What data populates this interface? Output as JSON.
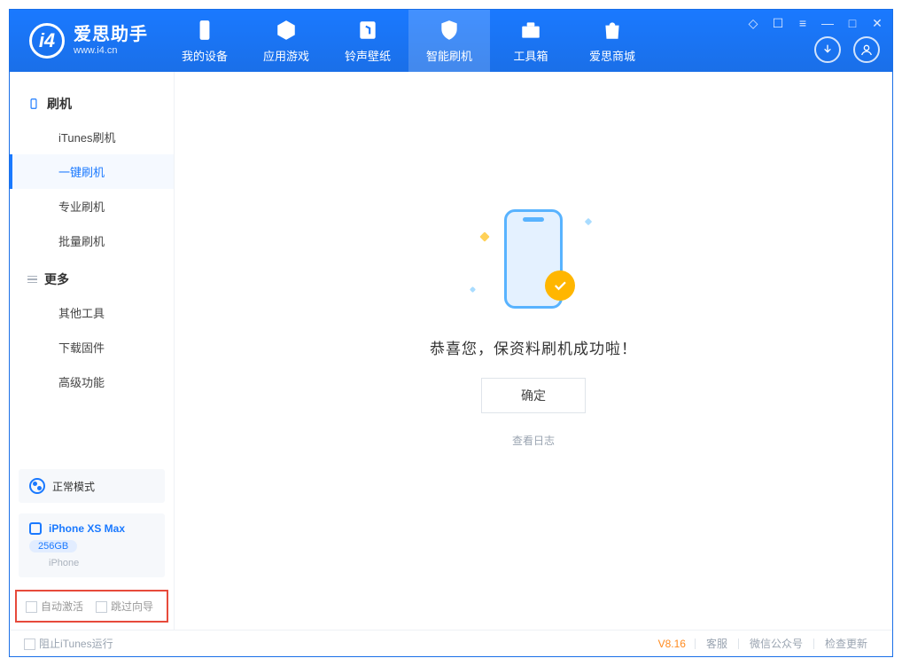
{
  "app": {
    "name_cn": "爱思助手",
    "url": "www.i4.cn"
  },
  "tabs": [
    {
      "label": "我的设备"
    },
    {
      "label": "应用游戏"
    },
    {
      "label": "铃声壁纸"
    },
    {
      "label": "智能刷机"
    },
    {
      "label": "工具箱"
    },
    {
      "label": "爱思商城"
    }
  ],
  "sidebar": {
    "group1": {
      "title": "刷机",
      "items": [
        "iTunes刷机",
        "一键刷机",
        "专业刷机",
        "批量刷机"
      ],
      "active_index": 1
    },
    "group2": {
      "title": "更多",
      "items": [
        "其他工具",
        "下载固件",
        "高级功能"
      ]
    }
  },
  "mode_panel": {
    "label": "正常模式"
  },
  "device": {
    "name": "iPhone XS Max",
    "capacity": "256GB",
    "type": "iPhone"
  },
  "options": {
    "auto_activate": "自动激活",
    "skip_guide": "跳过向导"
  },
  "result": {
    "message": "恭喜您，保资料刷机成功啦！",
    "ok_button": "确定",
    "log_link": "查看日志"
  },
  "footer": {
    "block_itunes": "阻止iTunes运行",
    "version": "V8.16",
    "links": [
      "客服",
      "微信公众号",
      "检查更新"
    ]
  }
}
